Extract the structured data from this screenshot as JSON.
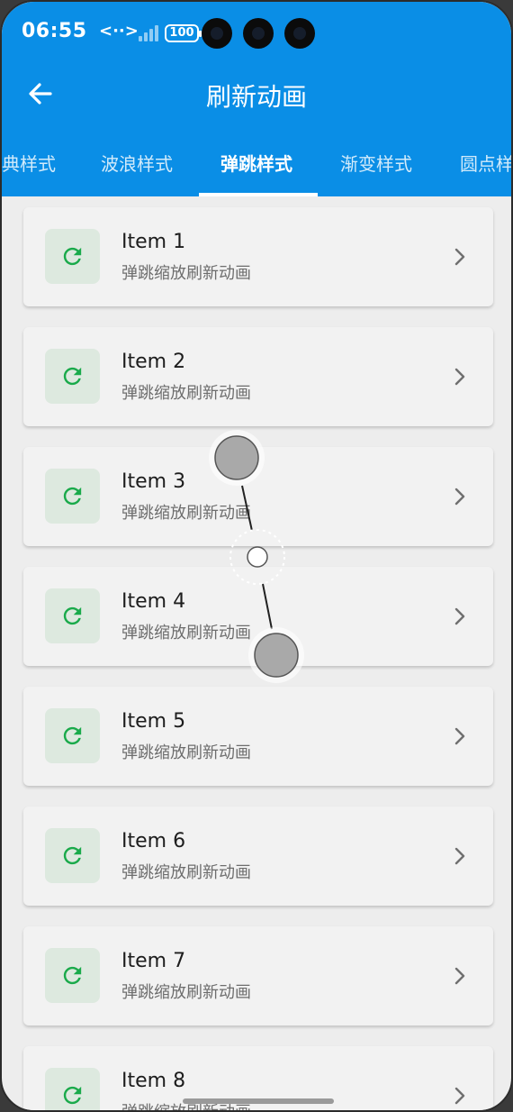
{
  "status_bar": {
    "time": "06:55",
    "network": "<··>",
    "battery": "100"
  },
  "header": {
    "title": "刷新动画",
    "background": "#0a8ee6"
  },
  "tabs": [
    {
      "label": "典样式",
      "active": false
    },
    {
      "label": "波浪样式",
      "active": false
    },
    {
      "label": "弹跳样式",
      "active": true
    },
    {
      "label": "渐变样式",
      "active": false
    },
    {
      "label": "圆点样",
      "active": false
    }
  ],
  "items": [
    {
      "title": "Item 1",
      "subtitle": "弹跳缩放刷新动画"
    },
    {
      "title": "Item 2",
      "subtitle": "弹跳缩放刷新动画"
    },
    {
      "title": "Item 3",
      "subtitle": "弹跳缩放刷新动画"
    },
    {
      "title": "Item 4",
      "subtitle": "弹跳缩放刷新动画"
    },
    {
      "title": "Item 5",
      "subtitle": "弹跳缩放刷新动画"
    },
    {
      "title": "Item 6",
      "subtitle": "弹跳缩放刷新动画"
    },
    {
      "title": "Item 7",
      "subtitle": "弹跳缩放刷新动画"
    },
    {
      "title": "Item 8",
      "subtitle": "弹跳缩放刷新动画"
    }
  ],
  "icons": {
    "back": "arrow-left-icon",
    "item": "refresh-icon",
    "trailing": "chevron-right-icon"
  },
  "colors": {
    "accent": "#0a8ee6",
    "refresh_icon": "#1aaa4b",
    "icon_tile": "#dde9df"
  }
}
